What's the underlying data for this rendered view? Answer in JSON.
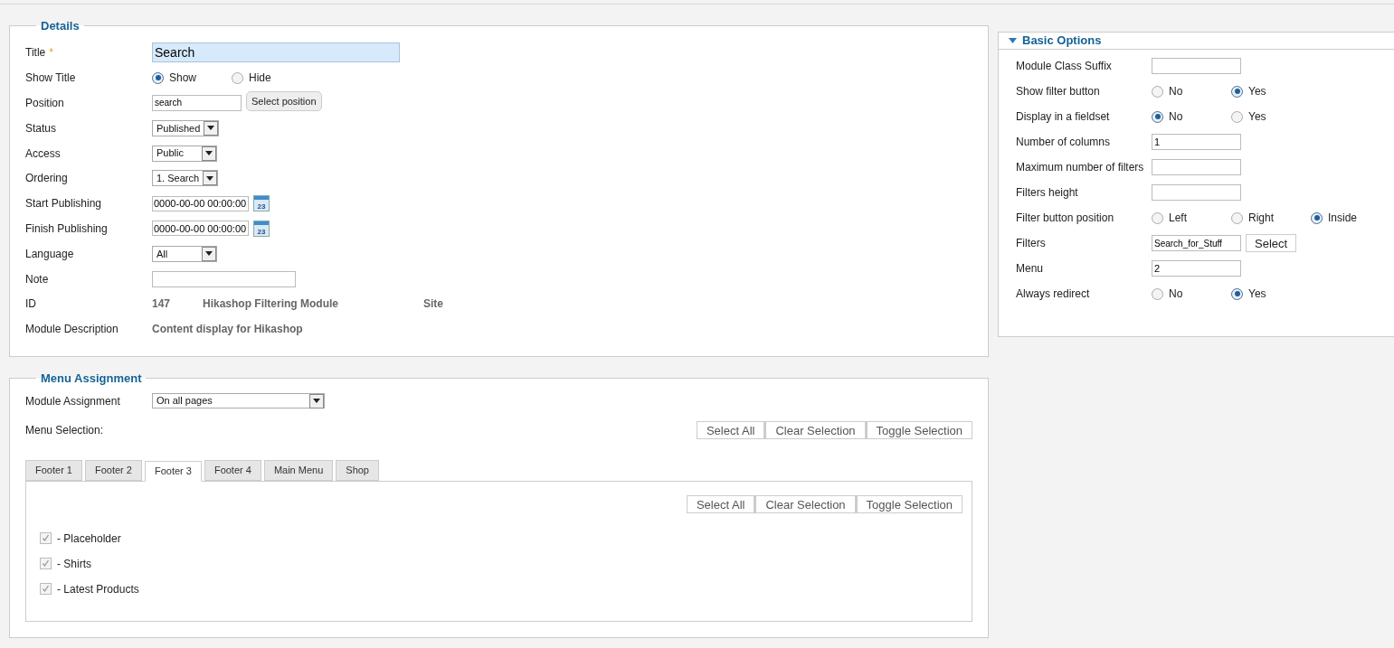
{
  "details": {
    "legend": "Details",
    "fields": [
      {
        "kind": "title_text",
        "label": "Title",
        "required_mark": "*",
        "value": "Search",
        "focused": true
      },
      {
        "kind": "radio",
        "label": "Show Title",
        "options": [
          {
            "label": "Show",
            "selected": true
          },
          {
            "label": "Hide",
            "selected": false
          }
        ]
      },
      {
        "kind": "text_button",
        "label": "Position",
        "value": "search",
        "button": "Select position"
      },
      {
        "kind": "select",
        "label": "Status",
        "value": "Published"
      },
      {
        "kind": "select",
        "label": "Access",
        "value": "Public"
      },
      {
        "kind": "select",
        "label": "Ordering",
        "value": "1. Search"
      },
      {
        "kind": "date",
        "label": "Start Publishing",
        "value": "0000-00-00 00:00:00",
        "calendar_day": "23"
      },
      {
        "kind": "date",
        "label": "Finish Publishing",
        "value": "0000-00-00 00:00:00",
        "calendar_day": "23"
      },
      {
        "kind": "select",
        "label": "Language",
        "value": "All"
      },
      {
        "kind": "text",
        "label": "Note"
      },
      {
        "kind": "info",
        "label": "ID",
        "values": [
          "147",
          "Hikashop Filtering Module",
          "Site"
        ]
      },
      {
        "kind": "info",
        "label": "Module Description",
        "values": [
          "Content display for Hikashop"
        ]
      }
    ]
  },
  "basic_options": {
    "title": "Basic Options",
    "expanded": true,
    "fields": [
      {
        "kind": "text",
        "label": "Module Class Suffix"
      },
      {
        "kind": "radio",
        "label": "Show filter button",
        "options": [
          {
            "label": "No",
            "selected": false
          },
          {
            "label": "Yes",
            "selected": true
          }
        ]
      },
      {
        "kind": "radio",
        "label": "Display in a fieldset",
        "options": [
          {
            "label": "No",
            "selected": true
          },
          {
            "label": "Yes",
            "selected": false
          }
        ]
      },
      {
        "kind": "text",
        "label": "Number of columns",
        "value": "1"
      },
      {
        "kind": "text",
        "label": "Maximum number of filters"
      },
      {
        "kind": "text",
        "label": "Filters height"
      },
      {
        "kind": "radio",
        "label": "Filter button position",
        "options": [
          {
            "label": "Left",
            "selected": false
          },
          {
            "label": "Right",
            "selected": false
          },
          {
            "label": "Inside",
            "selected": true
          }
        ]
      },
      {
        "kind": "text_button",
        "label": "Filters",
        "value": "Search_for_Stuff",
        "button": "Select"
      },
      {
        "kind": "text",
        "label": "Menu",
        "value": "2"
      },
      {
        "kind": "radio",
        "label": "Always redirect",
        "options": [
          {
            "label": "No",
            "selected": false
          },
          {
            "label": "Yes",
            "selected": true
          }
        ]
      }
    ]
  },
  "menu_assignment": {
    "legend": "Menu Assignment",
    "module_assignment": {
      "label": "Module Assignment",
      "value": "On all pages"
    },
    "menu_selection_label": "Menu Selection:",
    "buttons": [
      "Select All",
      "Clear Selection",
      "Toggle Selection"
    ],
    "tabs": [
      {
        "label": "Footer 1",
        "selected": false
      },
      {
        "label": "Footer 2",
        "selected": false
      },
      {
        "label": "Footer 3",
        "selected": true
      },
      {
        "label": "Footer 4",
        "selected": false
      },
      {
        "label": "Main Menu",
        "selected": false
      },
      {
        "label": "Shop",
        "selected": false
      }
    ],
    "panel_buttons": [
      "Select All",
      "Clear Selection",
      "Toggle Selection"
    ],
    "items": [
      {
        "label": "- Placeholder",
        "checked": true
      },
      {
        "label": "- Shirts",
        "checked": true
      },
      {
        "label": "- Latest Products",
        "checked": true
      }
    ]
  }
}
